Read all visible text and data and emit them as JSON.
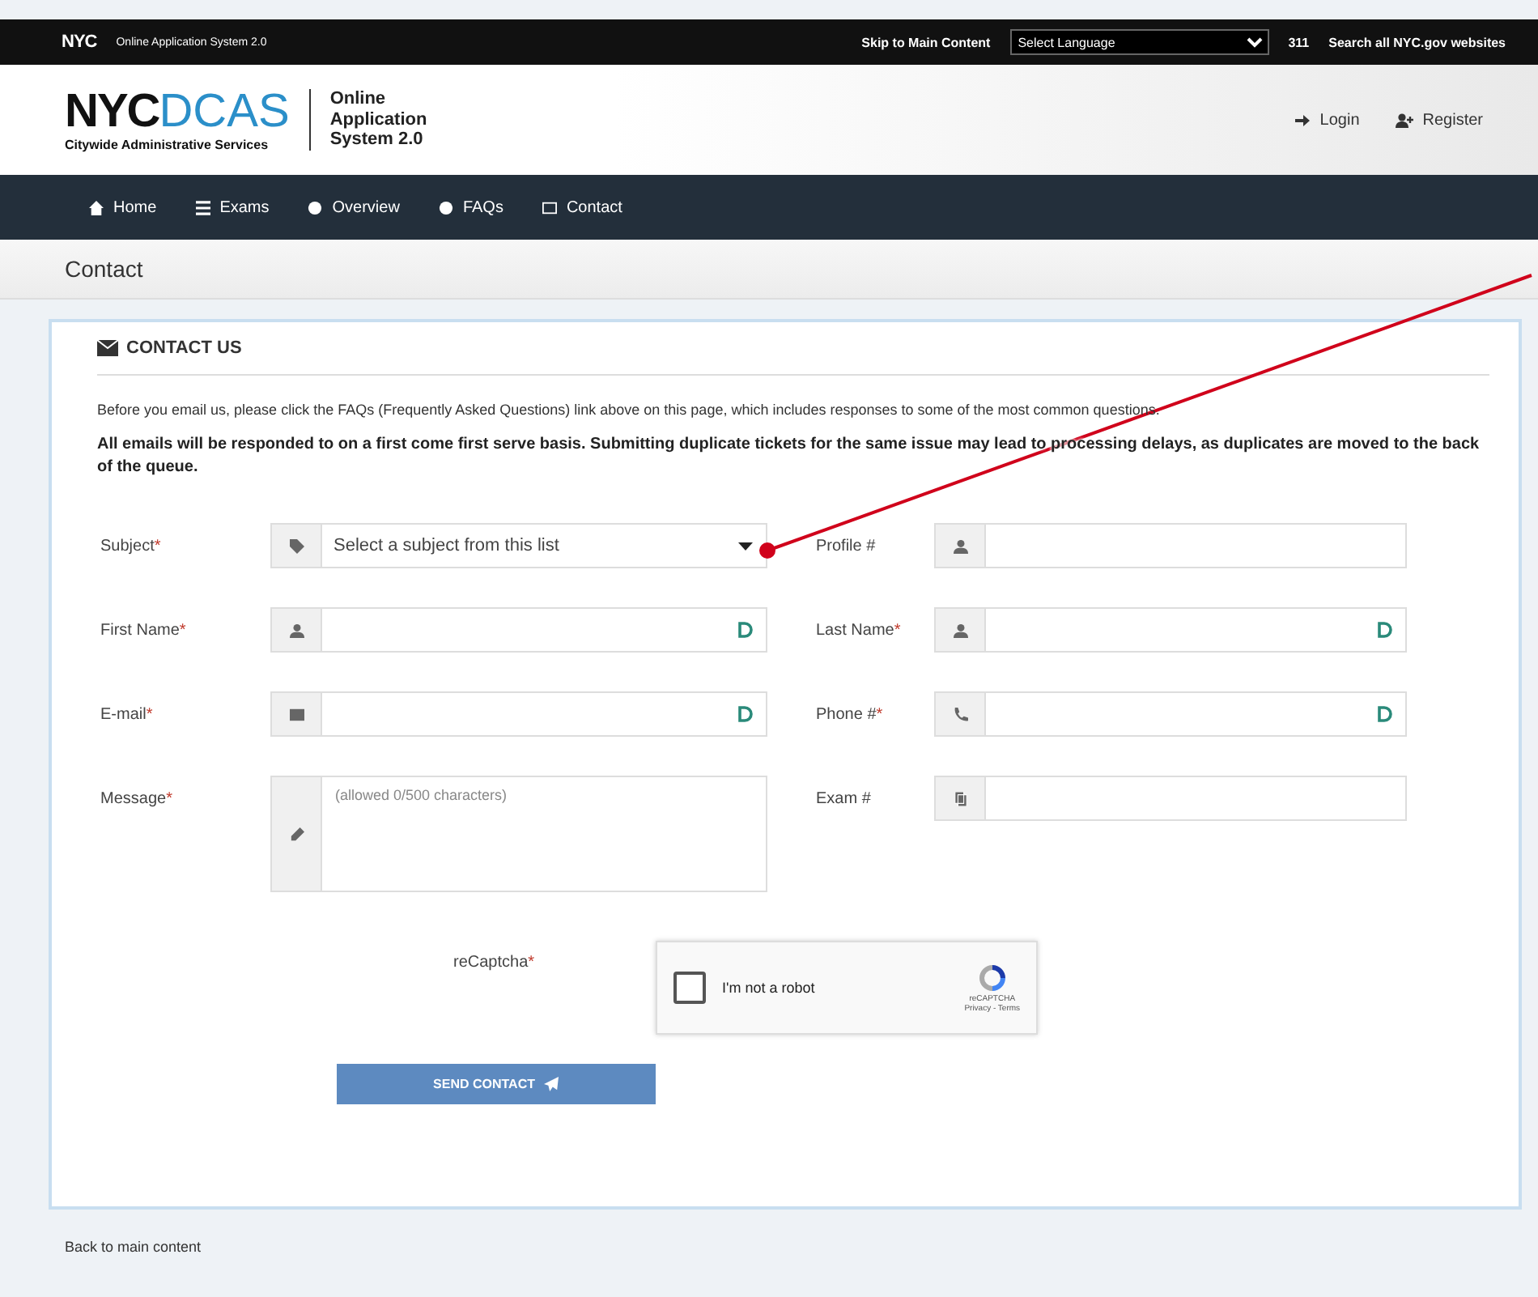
{
  "top_bar": {
    "logo": "NYC",
    "site": "Online Application System 2.0",
    "skip_link": "Skip to Main Content",
    "language_select": "Select Language",
    "phone": "311",
    "search_link": "Search all NYC.gov websites"
  },
  "header": {
    "logo_main": "NYC",
    "logo_accent": "DCAS",
    "logo_subtitle": "Citywide Administrative Services",
    "app_title": "Online Application System 2.0",
    "actions": [
      "Login",
      "Register"
    ]
  },
  "nav": [
    "Home",
    "Exams",
    "Overview",
    "FAQs",
    "Contact"
  ],
  "breadcrumb": "Contact",
  "panel": {
    "title": "CONTACT US",
    "intro": "Before you email us, please click the FAQs (Frequently Asked Questions) link above on this page, which includes responses to some of the most common questions.",
    "notice": "All emails will be responded to on a first come first serve basis. Submitting duplicate tickets for the same issue may lead to processing delays, as duplicates are moved to the back of the queue.",
    "fields": [
      {
        "label": "Subject",
        "required": true,
        "kind": "select",
        "value": "Select a subject from this list",
        "autofill": false
      },
      {
        "label": "Profile #",
        "required": false,
        "kind": "input",
        "autofill": false
      },
      {
        "label": "First Name",
        "required": true,
        "kind": "input",
        "autofill": true
      },
      {
        "label": "Last Name",
        "required": true,
        "kind": "input",
        "autofill": true
      },
      {
        "label": "E-mail",
        "required": true,
        "kind": "input",
        "autofill": true
      },
      {
        "label": "Phone #",
        "required": true,
        "kind": "input",
        "autofill": true
      },
      {
        "label": "Message",
        "required": true,
        "kind": "textarea",
        "placeholder": "(allowed 0/500 characters)",
        "autofill": false
      },
      {
        "label": "Exam #",
        "required": false,
        "kind": "input",
        "autofill": false
      }
    ],
    "captcha": {
      "label": "reCaptcha",
      "required": true,
      "checkbox_label": "I'm not a robot",
      "checked": false,
      "brand": "reCAPTCHA",
      "links": "Privacy - Terms"
    },
    "submit": "SEND CONTACT",
    "required_mark": "*"
  },
  "footer_link": "Back to main content"
}
